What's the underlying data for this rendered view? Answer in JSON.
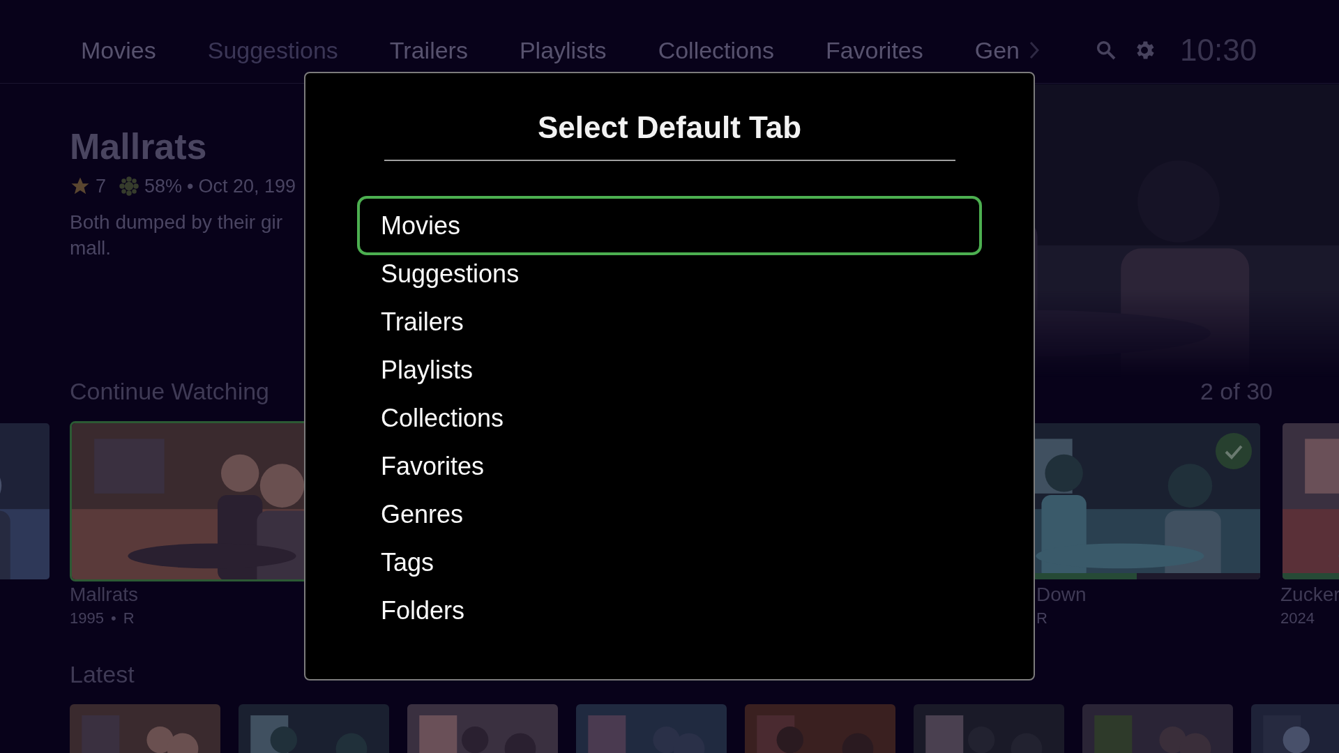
{
  "nav": {
    "tabs": [
      {
        "label": "Movies",
        "selected": false
      },
      {
        "label": "Suggestions",
        "selected": true
      },
      {
        "label": "Trailers",
        "selected": false
      },
      {
        "label": "Playlists",
        "selected": false
      },
      {
        "label": "Collections",
        "selected": false
      },
      {
        "label": "Favorites",
        "selected": false
      },
      {
        "label": "Gen",
        "selected": false
      }
    ],
    "clock": "10:30"
  },
  "featured": {
    "title": "Mallrats",
    "rating": "7",
    "critic_score": "58%",
    "separator": "•",
    "date": "Oct 20, 199",
    "description_lines": [
      "Both dumped by their gir",
      "mall."
    ]
  },
  "continue_watching": {
    "title": "Continue Watching",
    "position": "2 of 30",
    "cards": [
      {
        "focused": false,
        "watched": false
      },
      {
        "title": "Mallrats",
        "year": "1995",
        "separator": "•",
        "rating": "R",
        "focused": true,
        "watched": false
      },
      {
        "title": "Down",
        "rating": "R",
        "focused": false,
        "watched": true,
        "level": 0.56
      },
      {
        "title": "Zucker",
        "year": "2024",
        "focused": false,
        "watched": false,
        "level": 1
      }
    ]
  },
  "latest": {
    "title": "Latest"
  },
  "dialog": {
    "title": "Select Default Tab",
    "options": [
      {
        "label": "Movies",
        "selected": true
      },
      {
        "label": "Suggestions",
        "selected": false
      },
      {
        "label": "Trailers",
        "selected": false
      },
      {
        "label": "Playlists",
        "selected": false
      },
      {
        "label": "Collections",
        "selected": false
      },
      {
        "label": "Favorites",
        "selected": false
      },
      {
        "label": "Genres",
        "selected": false
      },
      {
        "label": "Tags",
        "selected": false
      },
      {
        "label": "Folders",
        "selected": false
      }
    ]
  }
}
